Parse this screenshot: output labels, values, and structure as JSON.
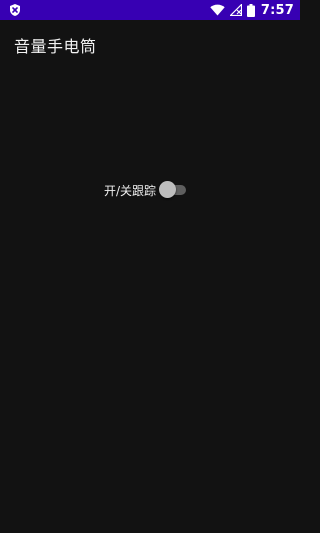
{
  "status_bar": {
    "time": "7:57",
    "bg_color": "#3700b3",
    "icons": [
      "shield-icon",
      "wifi-icon",
      "signal-icon",
      "battery-icon"
    ]
  },
  "app_bar": {
    "title": "音量手电筒"
  },
  "main": {
    "tracking_switch": {
      "label": "开/关跟踪",
      "checked": false
    }
  },
  "colors": {
    "background": "#121212",
    "switch_thumb": "#bdbdbd",
    "switch_track": "#5f5f5f"
  }
}
